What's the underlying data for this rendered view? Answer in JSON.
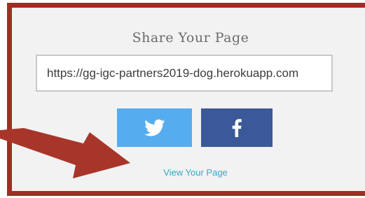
{
  "share": {
    "title": "Share Your Page",
    "url_value": "https://gg-igc-partners2019-dog.herokuapp.com"
  },
  "buttons": {
    "twitter_icon": "twitter-icon",
    "facebook_icon": "facebook-icon"
  },
  "link": {
    "view_label": "View Your Page"
  },
  "colors": {
    "frame_border": "#9c2f22",
    "twitter": "#55acee",
    "facebook": "#3b5998",
    "link": "#3aa7c9",
    "arrow": "#a8352a"
  }
}
